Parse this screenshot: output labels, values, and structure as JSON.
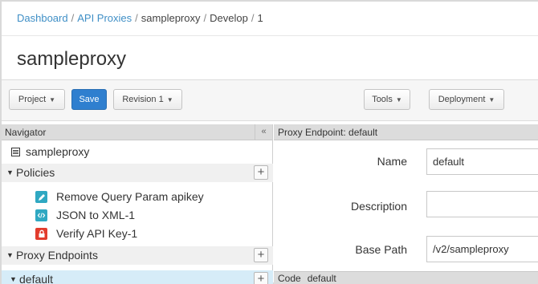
{
  "breadcrumb": {
    "dashboard": "Dashboard",
    "api_proxies": "API Proxies",
    "proxy": "sampleproxy",
    "develop": "Develop",
    "revision": "1",
    "separator": "/"
  },
  "page_title": "sampleproxy",
  "toolbar": {
    "project": "Project",
    "save": "Save",
    "revision": "Revision 1",
    "tools": "Tools",
    "deployment": "Deployment"
  },
  "navigator": {
    "title": "Navigator",
    "collapse": "«",
    "proxy_item": "sampleproxy",
    "policies_label": "Policies",
    "policies": [
      {
        "label": "Remove Query Param apikey",
        "icon": "remove-query-param-icon",
        "color": "#2fa8c2"
      },
      {
        "label": "JSON to XML-1",
        "icon": "json-to-xml-icon",
        "color": "#2fa8c2"
      },
      {
        "label": "Verify API Key-1",
        "icon": "lock-icon",
        "color": "#e23c2d"
      }
    ],
    "proxy_endpoints_label": "Proxy Endpoints",
    "default_label": "default",
    "plus": "+"
  },
  "endpoint": {
    "header": "Proxy Endpoint: default",
    "name_label": "Name",
    "name_value": "default",
    "description_label": "Description",
    "description_value": "",
    "base_path_label": "Base Path",
    "base_path_value": "/v2/sampleproxy",
    "code_label": "Code",
    "code_target": "default"
  },
  "colors": {
    "link": "#3f8fc6",
    "primary_button": "#2f7fcf",
    "selected_row": "#d6ecf8"
  }
}
